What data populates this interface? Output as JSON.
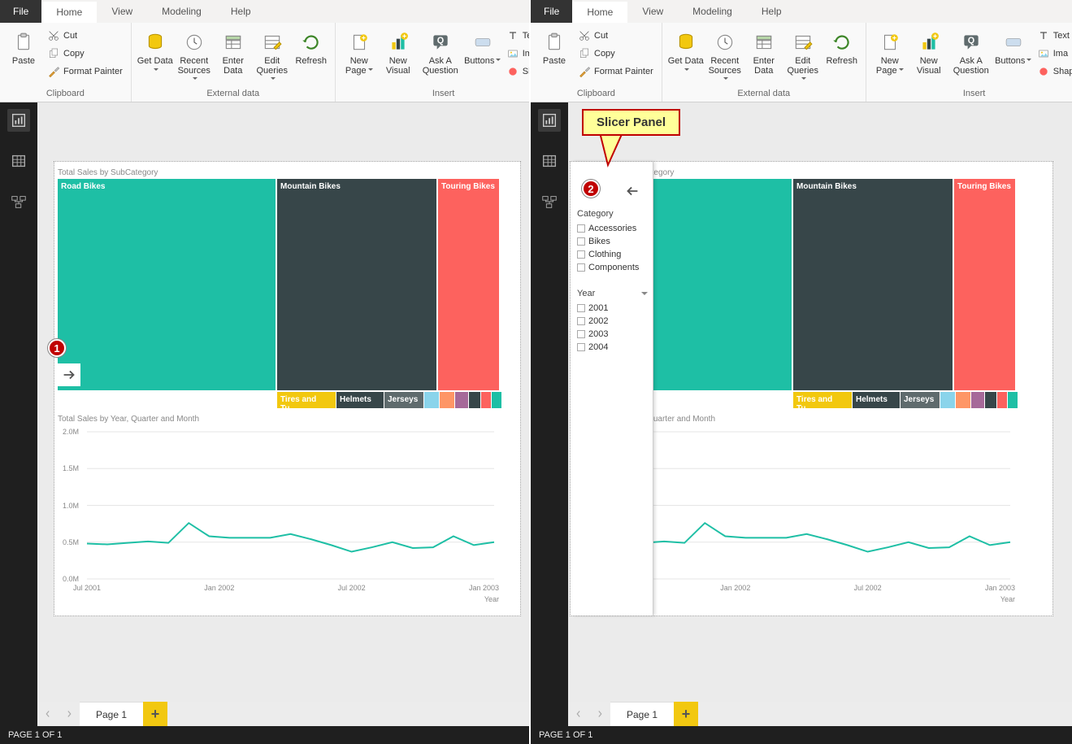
{
  "ribbon": {
    "file": "File",
    "tabs": [
      "Home",
      "View",
      "Modeling",
      "Help"
    ],
    "activeTab": "Home",
    "paste": "Paste",
    "cut": "Cut",
    "copy": "Copy",
    "formatPainter": "Format Painter",
    "getData": "Get Data",
    "recentSources": "Recent Sources",
    "enterData": "Enter Data",
    "editQueries": "Edit Queries",
    "refresh": "Refresh",
    "newPage": "New Page",
    "newVisual": "New Visual",
    "askA": "Ask A Question",
    "buttons": "Buttons",
    "textBox": "Text",
    "image": "Ima",
    "shapes": "Shap",
    "groups": {
      "clipboard": "Clipboard",
      "external": "External data",
      "insert": "Insert"
    }
  },
  "nav": {
    "report": "Report view",
    "data": "Data view",
    "model": "Model view"
  },
  "canvas": {
    "treemapTitle": "Total Sales by SubCategory",
    "lineTitle": "Total Sales by Year, Quarter and Month",
    "xAxisTitle": "Year"
  },
  "callout": {
    "slicerPanel": "Slicer Panel",
    "badge1": "1",
    "badge2": "2"
  },
  "slicers": {
    "category": {
      "label": "Category",
      "items": [
        "Accessories",
        "Bikes",
        "Clothing",
        "Components"
      ]
    },
    "year": {
      "label": "Year",
      "items": [
        "2001",
        "2002",
        "2003",
        "2004"
      ]
    }
  },
  "pageTabs": {
    "page1": "Page 1"
  },
  "status": "PAGE 1 OF 1",
  "chart_data": [
    {
      "type": "treemap",
      "title": "Total Sales by SubCategory",
      "items": [
        {
          "name": "Road Bikes",
          "value": 40,
          "color": "#1EBFA5"
        },
        {
          "name": "Mountain Bikes",
          "value": 28,
          "color": "#374649"
        },
        {
          "name": "Touring Bikes",
          "value": 12,
          "color": "#FD625E"
        },
        {
          "name": "Tires and Tu...",
          "value": 5,
          "color": "#F2C80F"
        },
        {
          "name": "Helmets",
          "value": 4,
          "color": "#374649"
        },
        {
          "name": "Jerseys",
          "value": 3.5,
          "color": "#5F6B6D"
        },
        {
          "name": "",
          "value": 1.2,
          "color": "#8AD4EB"
        },
        {
          "name": "",
          "value": 1.2,
          "color": "#FE9666"
        },
        {
          "name": "",
          "value": 1.0,
          "color": "#A66999"
        },
        {
          "name": "",
          "value": 0.8,
          "color": "#374649"
        },
        {
          "name": "",
          "value": 0.7,
          "color": "#FD625E"
        },
        {
          "name": "",
          "value": 0.6,
          "color": "#1EBFA5"
        },
        {
          "name": "",
          "value": 0.5,
          "color": "#F2C80F"
        },
        {
          "name": "",
          "value": 0.5,
          "color": "#5F6B6D"
        }
      ]
    },
    {
      "type": "line",
      "title": "Total Sales by Year, Quarter and Month",
      "xlabel": "Year",
      "ylabel": "",
      "ylim": [
        0,
        2000000
      ],
      "yticks": [
        {
          "v": 0,
          "label": "0.0M"
        },
        {
          "v": 500000,
          "label": "0.5M"
        },
        {
          "v": 1000000,
          "label": "1.0M"
        },
        {
          "v": 1500000,
          "label": "1.5M"
        },
        {
          "v": 2000000,
          "label": "2.0M"
        }
      ],
      "xtick_labels": [
        "Jul 2001",
        "Jan 2002",
        "Jul 2002",
        "Jan 2003"
      ],
      "x": [
        0,
        1,
        2,
        3,
        4,
        5,
        6,
        7,
        8,
        9,
        10,
        11,
        12,
        13,
        14,
        15,
        16,
        17,
        18,
        19,
        20
      ],
      "series": [
        {
          "name": "Total Sales",
          "color": "#1EBFA5",
          "values": [
            480000,
            470000,
            490000,
            510000,
            490000,
            760000,
            580000,
            560000,
            560000,
            560000,
            610000,
            540000,
            460000,
            370000,
            430000,
            500000,
            420000,
            430000,
            580000,
            460000,
            500000
          ]
        }
      ]
    }
  ]
}
